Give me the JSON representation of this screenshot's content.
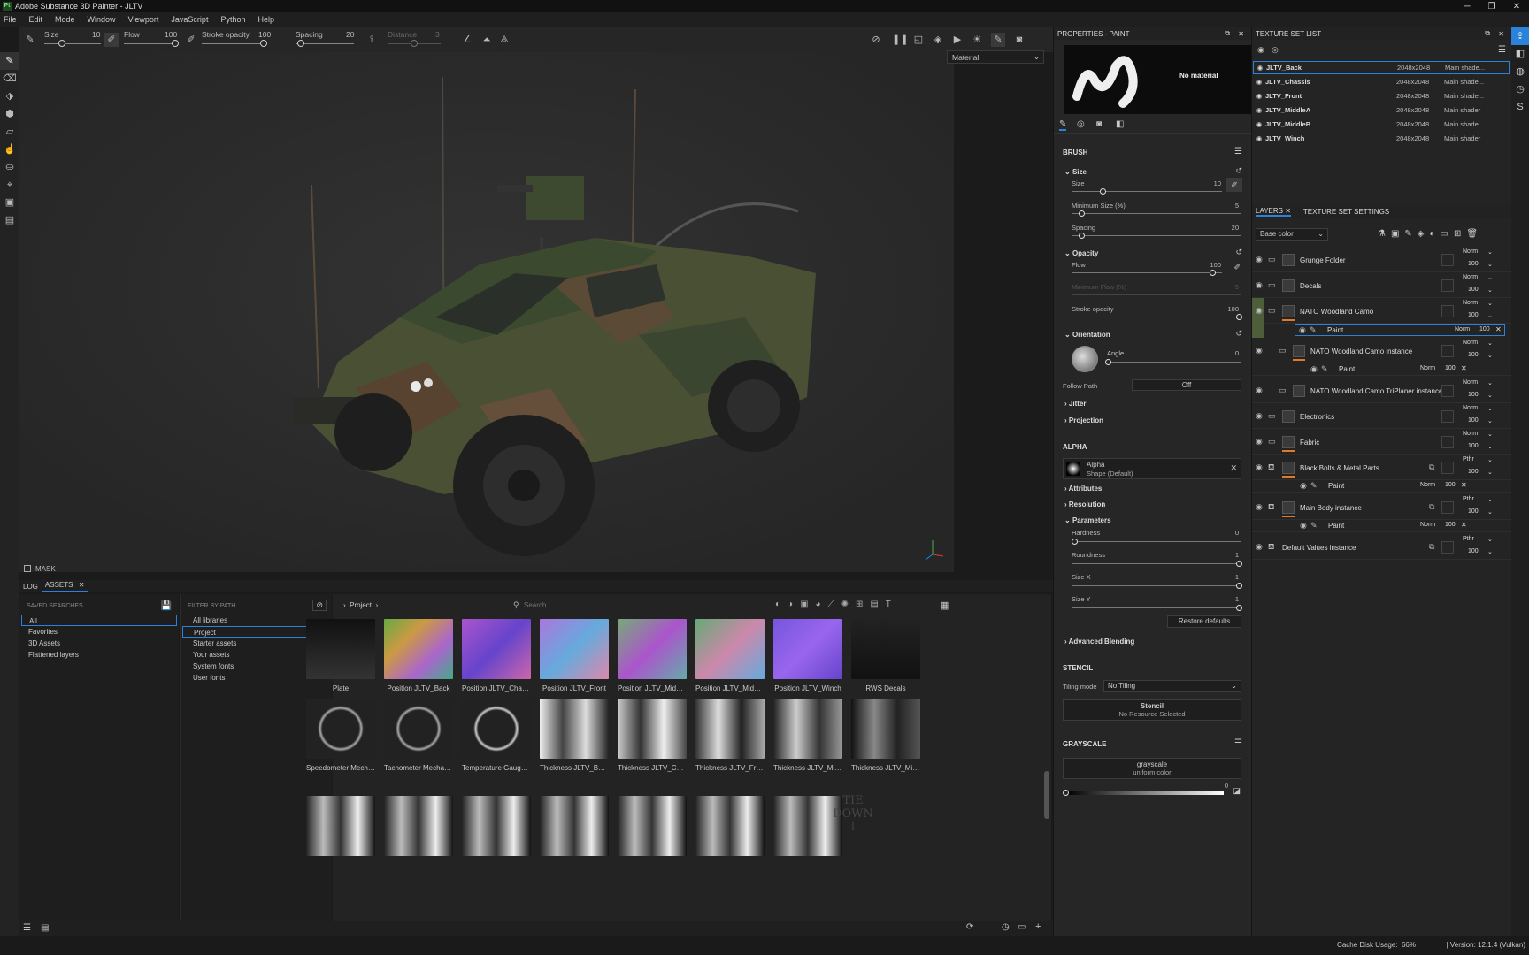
{
  "app": {
    "title": "Adobe Substance 3D Painter - JLTV",
    "logo": "Pt"
  },
  "menu": [
    "File",
    "Edit",
    "Mode",
    "Window",
    "Viewport",
    "JavaScript",
    "Python",
    "Help"
  ],
  "toolbar": {
    "size_label": "Size",
    "size_value": "10",
    "flow_label": "Flow",
    "flow_value": "100",
    "stroke_label": "Stroke opacity",
    "stroke_value": "100",
    "spacing_label": "Spacing",
    "spacing_value": "20",
    "distance_label": "Distance",
    "distance_value": "3"
  },
  "viewport": {
    "mode": "Material",
    "mask_label": "MASK"
  },
  "properties": {
    "title": "PROPERTIES - PAINT",
    "material": "No material",
    "brush_header": "BRUSH",
    "size_section": "Size",
    "size_label": "Size",
    "size_value": "10",
    "min_size_label": "Minimum Size (%)",
    "min_size_value": "5",
    "spacing_label": "Spacing",
    "spacing_value": "20",
    "opacity_section": "Opacity",
    "flow_label": "Flow",
    "flow_value": "100",
    "min_flow_label": "Minimum Flow (%)",
    "min_flow_value": "5",
    "stroke_label": "Stroke opacity",
    "stroke_value": "100",
    "orientation_section": "Orientation",
    "angle_label": "Angle",
    "angle_value": "0",
    "follow_path_label": "Follow Path",
    "follow_path_value": "Off",
    "jitter": "Jitter",
    "projection": "Projection",
    "alpha_header": "ALPHA",
    "alpha_name": "Alpha",
    "alpha_sub": "Shape (Default)",
    "attributes": "Attributes",
    "resolution": "Resolution",
    "parameters": "Parameters",
    "hardness_label": "Hardness",
    "hardness_value": "0",
    "roundness_label": "Roundness",
    "roundness_value": "1",
    "sizex_label": "Size X",
    "sizex_value": "1",
    "sizey_label": "Size Y",
    "sizey_value": "1",
    "restore": "Restore defaults",
    "adv_blending": "Advanced Blending",
    "stencil_header": "STENCIL",
    "tiling_label": "Tiling mode",
    "tiling_value": "No Tiling",
    "stencil_name": "Stencil",
    "stencil_sub": "No Resource Selected",
    "grayscale_header": "GRAYSCALE",
    "gray_name": "grayscale",
    "gray_sub": "uniform color",
    "gray_value": "0"
  },
  "texture_sets": {
    "title": "TEXTURE SET LIST",
    "rows": [
      {
        "name": "JLTV_Back",
        "res": "2048x2048",
        "shader": "Main shade..."
      },
      {
        "name": "JLTV_Chassis",
        "res": "2048x2048",
        "shader": "Main shade..."
      },
      {
        "name": "JLTV_Front",
        "res": "2048x2048",
        "shader": "Main shade..."
      },
      {
        "name": "JLTV_MiddleA",
        "res": "2048x2048",
        "shader": "Main shader"
      },
      {
        "name": "JLTV_MiddleB",
        "res": "2048x2048",
        "shader": "Main shade..."
      },
      {
        "name": "JLTV_Winch",
        "res": "2048x2048",
        "shader": "Main shader"
      }
    ]
  },
  "layers": {
    "tab_layers": "LAYERS",
    "tab_tss": "TEXTURE SET SETTINGS",
    "channel": "Base color",
    "rows": [
      {
        "name": "Grunge Folder",
        "blend": "Norm",
        "op": "100"
      },
      {
        "name": "Decals",
        "blend": "Norm",
        "op": "100"
      },
      {
        "name": "NATO Woodland Camo",
        "blend": "Norm",
        "op": "100"
      },
      {
        "name": "Paint",
        "blend": "Norm",
        "op": "100"
      },
      {
        "name": "NATO Woodland Camo instance",
        "blend": "Norm",
        "op": "100"
      },
      {
        "name": "Paint",
        "blend": "Norm",
        "op": "100"
      },
      {
        "name": "NATO Woodland Camo TriPlaner instance",
        "blend": "Norm",
        "op": "100"
      },
      {
        "name": "Electronics",
        "blend": "Norm",
        "op": "100"
      },
      {
        "name": "Fabric",
        "blend": "Norm",
        "op": "100"
      },
      {
        "name": "Black Bolts & Metal Parts",
        "blend": "Pthr",
        "op": "100"
      },
      {
        "name": "Paint",
        "blend": "Norm",
        "op": "100"
      },
      {
        "name": "Main Body instance",
        "blend": "Pthr",
        "op": "100"
      },
      {
        "name": "Paint",
        "blend": "Norm",
        "op": "100"
      },
      {
        "name": "Default Values instance",
        "blend": "Pthr",
        "op": "100"
      }
    ]
  },
  "assets": {
    "tab_log": "LOG",
    "tab_assets": "ASSETS",
    "saved_header": "SAVED SEARCHES",
    "saved": [
      "All",
      "Favorites",
      "3D Assets",
      "Flattened layers"
    ],
    "filter_header": "FILTER BY PATH",
    "filter": [
      "All libraries",
      "Project",
      "Starter assets",
      "Your assets",
      "System fonts",
      "User fonts"
    ],
    "breadcrumb": "Project",
    "search_placeholder": "Search",
    "items": [
      "Plate",
      "Position JLTV_Back",
      "Position JLTV_Chassis",
      "Position JLTV_Front",
      "Position JLTV_MiddleA",
      "Position JLTV_MiddleB",
      "Position JLTV_Winch",
      "RWS Decals",
      "Speedometer Mecha...",
      "Tachometer Mechan...",
      "Temperature Gauge ...",
      "Thickness JLTV_Back",
      "Thickness JLTV_Chas...",
      "Thickness JLTV_Front",
      "Thickness JLTV_Mid...",
      "Thickness JLTV_Mid..."
    ],
    "tiedown": "TIE DOWN"
  },
  "status": {
    "cache": "Cache Disk Usage:",
    "cache_value": "66%",
    "version": "Version: 12.1.4 (Vulkan)"
  }
}
